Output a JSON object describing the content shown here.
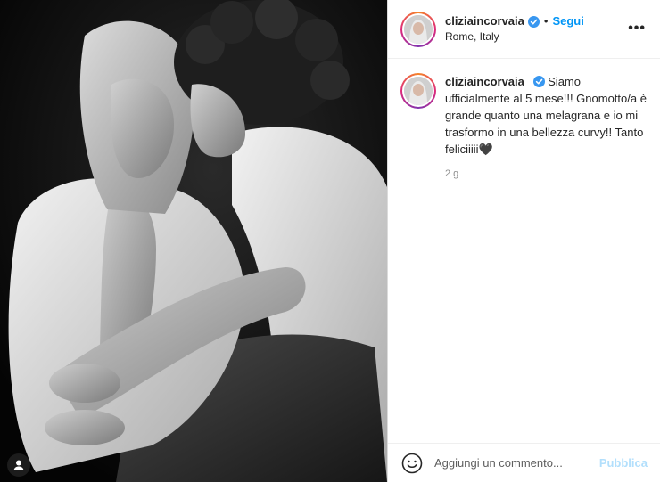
{
  "post": {
    "image_alt": "Black-and-white photo of a couple, the woman in an open white shirt cradling her belly while the man kisses her cheek",
    "tag_icon": "user-tag-icon"
  },
  "header": {
    "username": "cliziaincorvaia",
    "verified_icon": "verified-badge-icon",
    "separator": "•",
    "follow_label": "Segui",
    "location": "Rome, Italy",
    "more_icon": "more-options-icon",
    "more_label": "•••"
  },
  "caption": {
    "username": "cliziaincorvaia",
    "text": "Siamo ufficialmente al 5 mese!!! Gnomotto/a è grande quanto una melagrana e io mi trasformo in una bellezza curvy!! Tanto feliciiiii🖤",
    "timestamp": "2 g"
  },
  "comment": {
    "emoji_icon": "emoji-smile-icon",
    "placeholder": "Aggiungi un commento...",
    "publish_label": "Pubblica"
  },
  "colors": {
    "accent": "#0095f6",
    "publish_disabled": "#b2dffc",
    "verified": "#3897f0",
    "photo_background": "#050505"
  }
}
